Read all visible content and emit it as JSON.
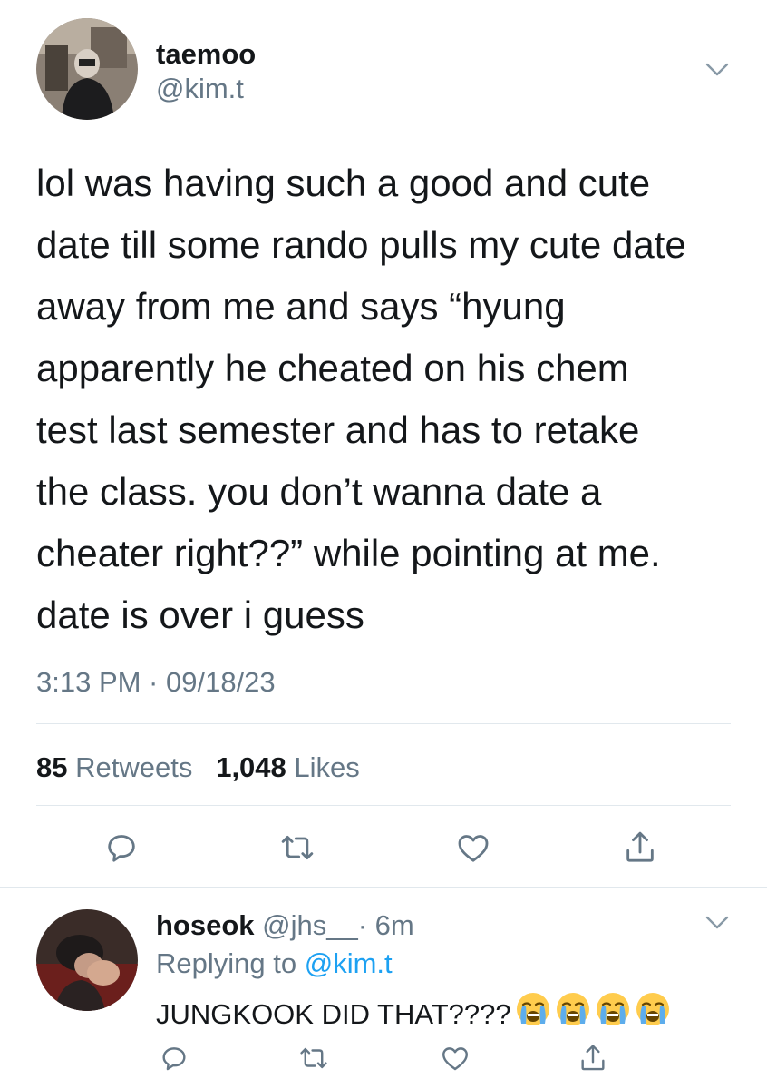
{
  "tweet": {
    "display_name": "taemoo",
    "handle": "@kim.t",
    "lines": [
      "lol was having such a good and cute",
      "date till some rando pulls my cute date",
      "away from me and says “hyung",
      "apparently he cheated on his chem",
      "test last semester and has to retake",
      "the class. you don’t wanna date a",
      "cheater right??” while pointing at me.",
      "date is over i guess"
    ],
    "timestamp": "3:13 PM · 09/18/23",
    "stats": {
      "retweets_count": "85",
      "retweets_label": "Retweets",
      "likes_count": "1,048",
      "likes_label": "Likes"
    },
    "actions": [
      "reply-icon",
      "retweet-icon",
      "like-icon",
      "share-icon"
    ]
  },
  "reply": {
    "display_name": "hoseok",
    "handle": "@jhs__",
    "time": "· 6m",
    "replying_prefix": "Replying to",
    "replying_to": "@kim.t",
    "text": "JUNGKOOK DID THAT????",
    "emoji_name": "loudly-crying-face-icon",
    "emoji_count": 4
  },
  "colors": {
    "text": "#14171a",
    "secondary": "#657786",
    "link": "#1da1f2",
    "divider": "#e1e8ed"
  }
}
